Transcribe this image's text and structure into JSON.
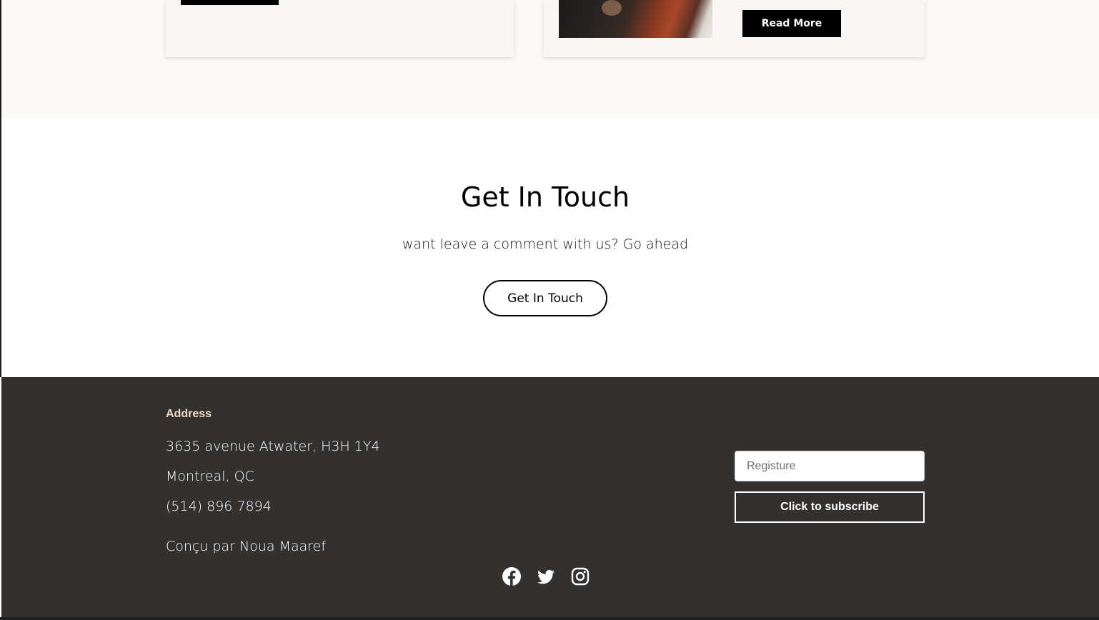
{
  "cards": {
    "read_more_label": "Read More"
  },
  "contact": {
    "title": "Get In Touch",
    "subtitle": "want leave a comment with us? Go ahead",
    "button_label": "Get In Touch"
  },
  "footer": {
    "address_heading": "Address",
    "address_line1": "3635 avenue Atwater, H3H 1Y4",
    "address_line2": "Montreal, QC",
    "phone": "(514) 896 7894",
    "credit": "Conçu par Noua Maaref",
    "subscribe": {
      "placeholder": "Registure",
      "button_label": "Click to subscribe"
    },
    "socials": [
      "facebook-icon",
      "twitter-icon",
      "instagram-icon"
    ]
  },
  "colors": {
    "footer_bg": "#323130",
    "accent_heading": "#f1dcc9",
    "cards_bg": "#fcfaf6"
  }
}
